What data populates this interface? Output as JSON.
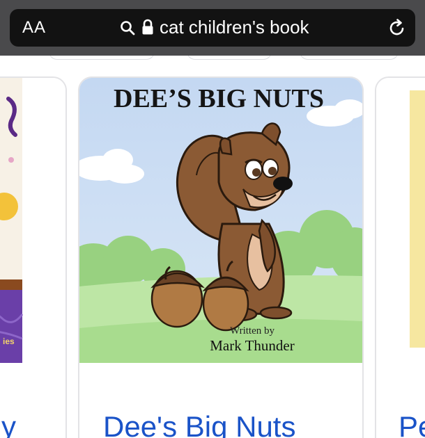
{
  "browser": {
    "text_size_label": "AA",
    "address_query": "cat children's book",
    "colors": {
      "bar": "#4a4a4c",
      "field": "#121212",
      "text": "#ffffff"
    }
  },
  "results": {
    "left_card": {
      "title_fragment": "y",
      "cover_fragment": "ies"
    },
    "center_card": {
      "cover_title": "DEE’S BIG NUTS",
      "cover_byline": "Written by",
      "cover_author": "Mark Thunder",
      "title": "Dee's Big Nuts"
    },
    "right_card": {
      "title_fragment": "Pe"
    },
    "colors": {
      "link": "#1a53c8",
      "card_border": "#e3e3e6"
    }
  },
  "icons": [
    "search-icon",
    "lock-icon",
    "reload-icon"
  ]
}
